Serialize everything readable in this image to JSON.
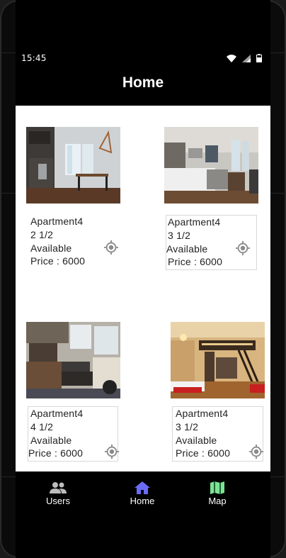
{
  "status_bar": {
    "time": "15:45",
    "icons": [
      "wifi-icon",
      "cellular-signal-icon",
      "battery-icon"
    ]
  },
  "header": {
    "title": "Home"
  },
  "listings": [
    {
      "name": "Apartment4",
      "rooms": "2 1/2",
      "status": "Available",
      "price": "Price : 6000"
    },
    {
      "name": "Apartment4",
      "rooms": "3 1/2",
      "status": "Available",
      "price": "Price : 6000"
    },
    {
      "name": "Apartment4",
      "rooms": "4 1/2",
      "status": "Available",
      "price": "Price : 6000"
    },
    {
      "name": "Apartment4",
      "rooms": "3 1/2",
      "status": "Available",
      "price": "Price : 6000"
    }
  ],
  "bottom_nav": {
    "items": [
      {
        "label": "Users",
        "icon": "users-icon",
        "color": "#bdbdbd"
      },
      {
        "label": "Home",
        "icon": "home-icon",
        "color": "#6a6cf6",
        "active": true
      },
      {
        "label": "Map",
        "icon": "map-icon",
        "color": "#7be495"
      }
    ]
  },
  "colors": {
    "screen_background": "#000000",
    "content_background": "#ffffff",
    "nav_home_accent": "#6a6cf6",
    "nav_map_accent": "#7be495",
    "nav_users_icon": "#bdbdbd",
    "locate_icon": "#8a8a8a"
  }
}
